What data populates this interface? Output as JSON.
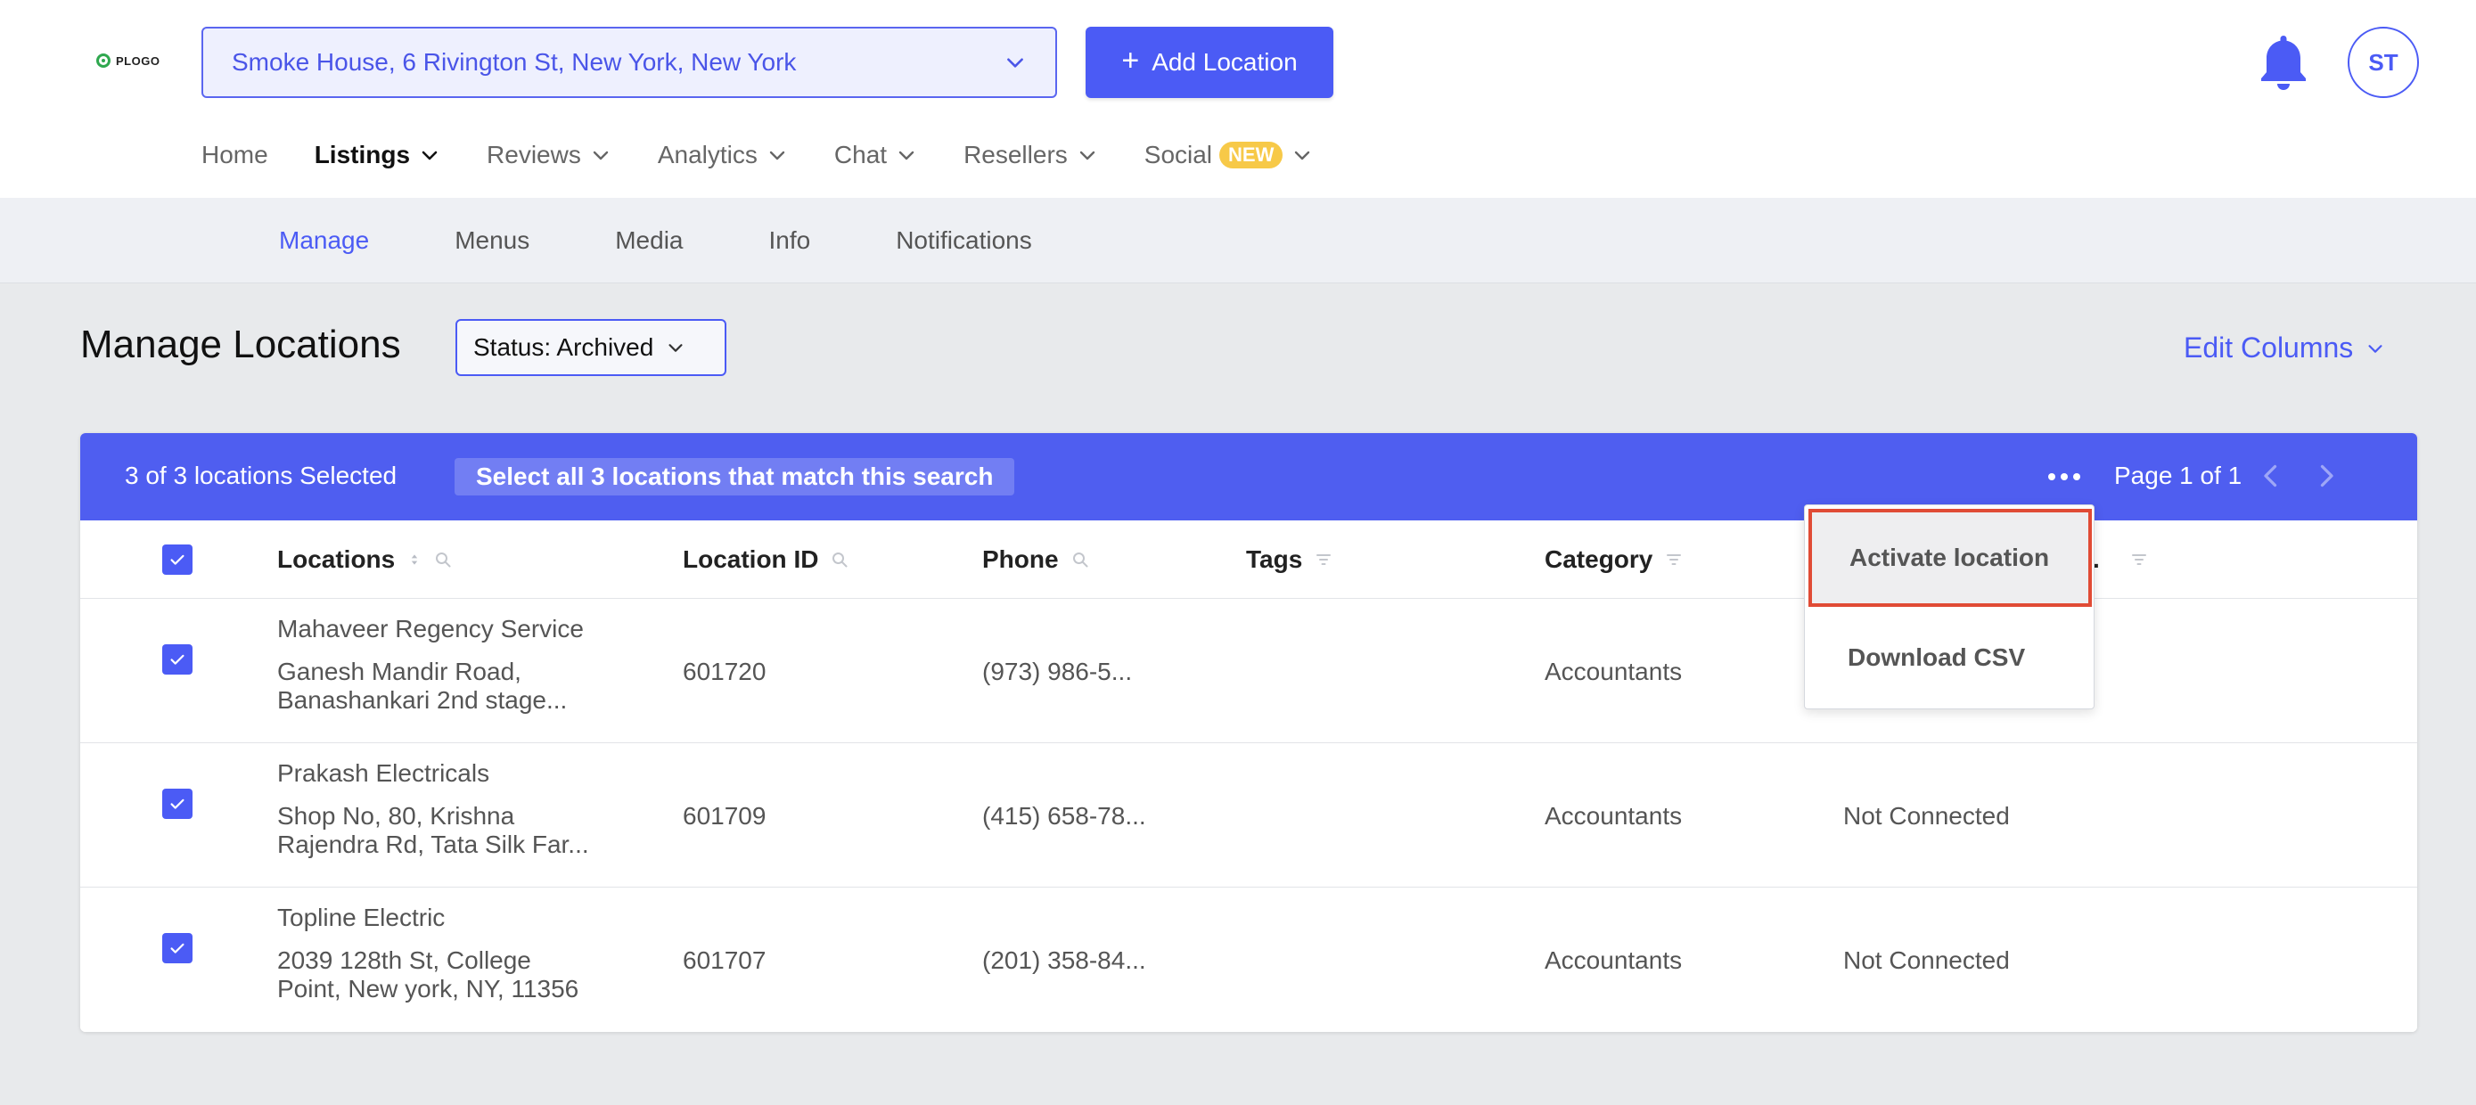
{
  "header": {
    "logo_text": "PLOGO",
    "location_select": "Smoke House, 6 Rivington St, New York, New York",
    "add_location_plus": "+",
    "add_location_label": "Add Location",
    "avatar_initials": "ST",
    "bell_icon": "bell-icon"
  },
  "main_nav": {
    "home": "Home",
    "listings": "Listings",
    "reviews": "Reviews",
    "analytics": "Analytics",
    "chat": "Chat",
    "resellers": "Resellers",
    "social": "Social",
    "social_badge": "NEW",
    "active": "Listings"
  },
  "sub_nav": {
    "manage": "Manage",
    "menus": "Menus",
    "media": "Media",
    "info": "Info",
    "notifications": "Notifications",
    "active": "Manage"
  },
  "page": {
    "title": "Manage Locations",
    "status_filter": "Status: Archived",
    "edit_columns": "Edit Columns"
  },
  "selection_bar": {
    "count_text": "3 of 3 locations Selected",
    "select_all_text": "Select all 3 locations that match this search",
    "page_info": "Page 1 of 1"
  },
  "table": {
    "columns": {
      "locations": "Locations",
      "location_id": "Location ID",
      "phone": "Phone",
      "tags": "Tags",
      "category": "Category",
      "partial": "."
    },
    "rows": [
      {
        "name": "Mahaveer Regency Service",
        "address_line1": "Ganesh Mandir Road,",
        "address_line2": "Banashankari 2nd stage...",
        "location_id": "601720",
        "phone": "(973) 986-5...",
        "tags": "",
        "category": "Accountants",
        "status": "",
        "checked": true
      },
      {
        "name": "Prakash Electricals",
        "address_line1": "Shop No, 80, Krishna",
        "address_line2": "Rajendra Rd, Tata Silk Far...",
        "location_id": "601709",
        "phone": "(415) 658-78...",
        "tags": "",
        "category": "Accountants",
        "status": "Not Connected",
        "checked": true
      },
      {
        "name": "Topline Electric",
        "address_line1": "2039 128th St, College",
        "address_line2": "Point, New york, NY, 11356",
        "location_id": "601707",
        "phone": "(201) 358-84...",
        "tags": "",
        "category": "Accountants",
        "status": "Not Connected",
        "checked": true
      }
    ]
  },
  "actions_menu": {
    "items": [
      "Activate location",
      "Download CSV"
    ],
    "highlighted": "Activate location",
    "highlight_color": "#e04b35"
  },
  "colors": {
    "accent": "#4b5bf5",
    "selection_bar": "#4f5ef0",
    "badge_new": "#f7c948",
    "logo_green": "#2fa84f"
  }
}
